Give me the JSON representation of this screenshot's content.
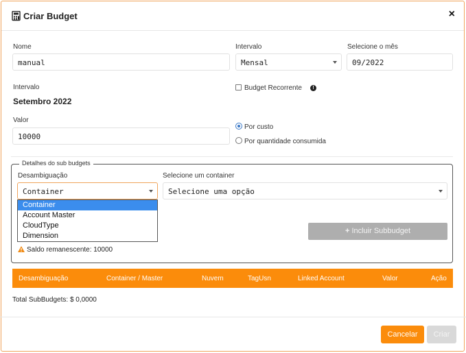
{
  "modal": {
    "title": "Criar Budget",
    "close_symbol": "×"
  },
  "form": {
    "nome": {
      "label": "Nome",
      "value": "manual"
    },
    "intervalo_select": {
      "label": "Intervalo",
      "value": "Mensal"
    },
    "mes": {
      "label": "Selecione o mês",
      "value": "09/2022"
    },
    "intervalo_info": {
      "label": "Intervalo",
      "value": "Setembro 2022"
    },
    "recorrente": {
      "label": "Budget Recorrente",
      "checked": false,
      "info_symbol": "!"
    },
    "valor": {
      "label": "Valor",
      "value": "10000"
    },
    "tipo": {
      "options": [
        "Por custo",
        "Por quantidade consumida"
      ],
      "selected": "Por custo"
    }
  },
  "subbudgets": {
    "legend": "Detalhes do sub budgets",
    "desambiguacao": {
      "label": "Desambiguação",
      "value": "Container",
      "options": [
        "Container",
        "Account Master",
        "CloudType",
        "Dimension"
      ]
    },
    "container": {
      "label": "Selecione um container",
      "value": "Selecione uma opção"
    },
    "add_button": "Incluir Subbudget",
    "saldo": "Saldo remanescente: 10000"
  },
  "table": {
    "columns": [
      "Desambiguação",
      "Container / Master",
      "Nuvem",
      "TagUsn",
      "Linked Account",
      "Valor",
      "Ação"
    ]
  },
  "total": "Total SubBudgets: $ 0,0000",
  "footer": {
    "cancel": "Cancelar",
    "create": "Criar"
  },
  "colors": {
    "accent": "#fb8c0b",
    "selected": "#3b8ded",
    "disabled": "#aeaeae"
  }
}
